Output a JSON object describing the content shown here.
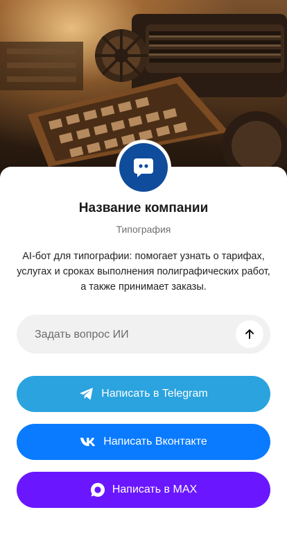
{
  "hero": {
    "image": "printing-press-photo"
  },
  "company": {
    "name": "Название компании",
    "subtitle": "Типография",
    "description": "AI-бот для типографии: помогает узнать о тарифах, услугах и сроках выполнения полиграфических работ, а также принимает заказы."
  },
  "ask": {
    "placeholder": "Задать вопрос ИИ",
    "send_icon": "arrow-up-icon"
  },
  "buttons": {
    "telegram": {
      "label": "Написать в Telegram",
      "icon": "telegram-icon",
      "color": "#2aa3df"
    },
    "vk": {
      "label": "Написать Вконтакте",
      "icon": "vk-icon",
      "color": "#0a7bff"
    },
    "max": {
      "label": "Написать в MAX",
      "icon": "max-icon",
      "color": "#6a17ff"
    }
  },
  "colors": {
    "avatar": "#0f4c9c",
    "input_bg": "#f1f1f1"
  }
}
